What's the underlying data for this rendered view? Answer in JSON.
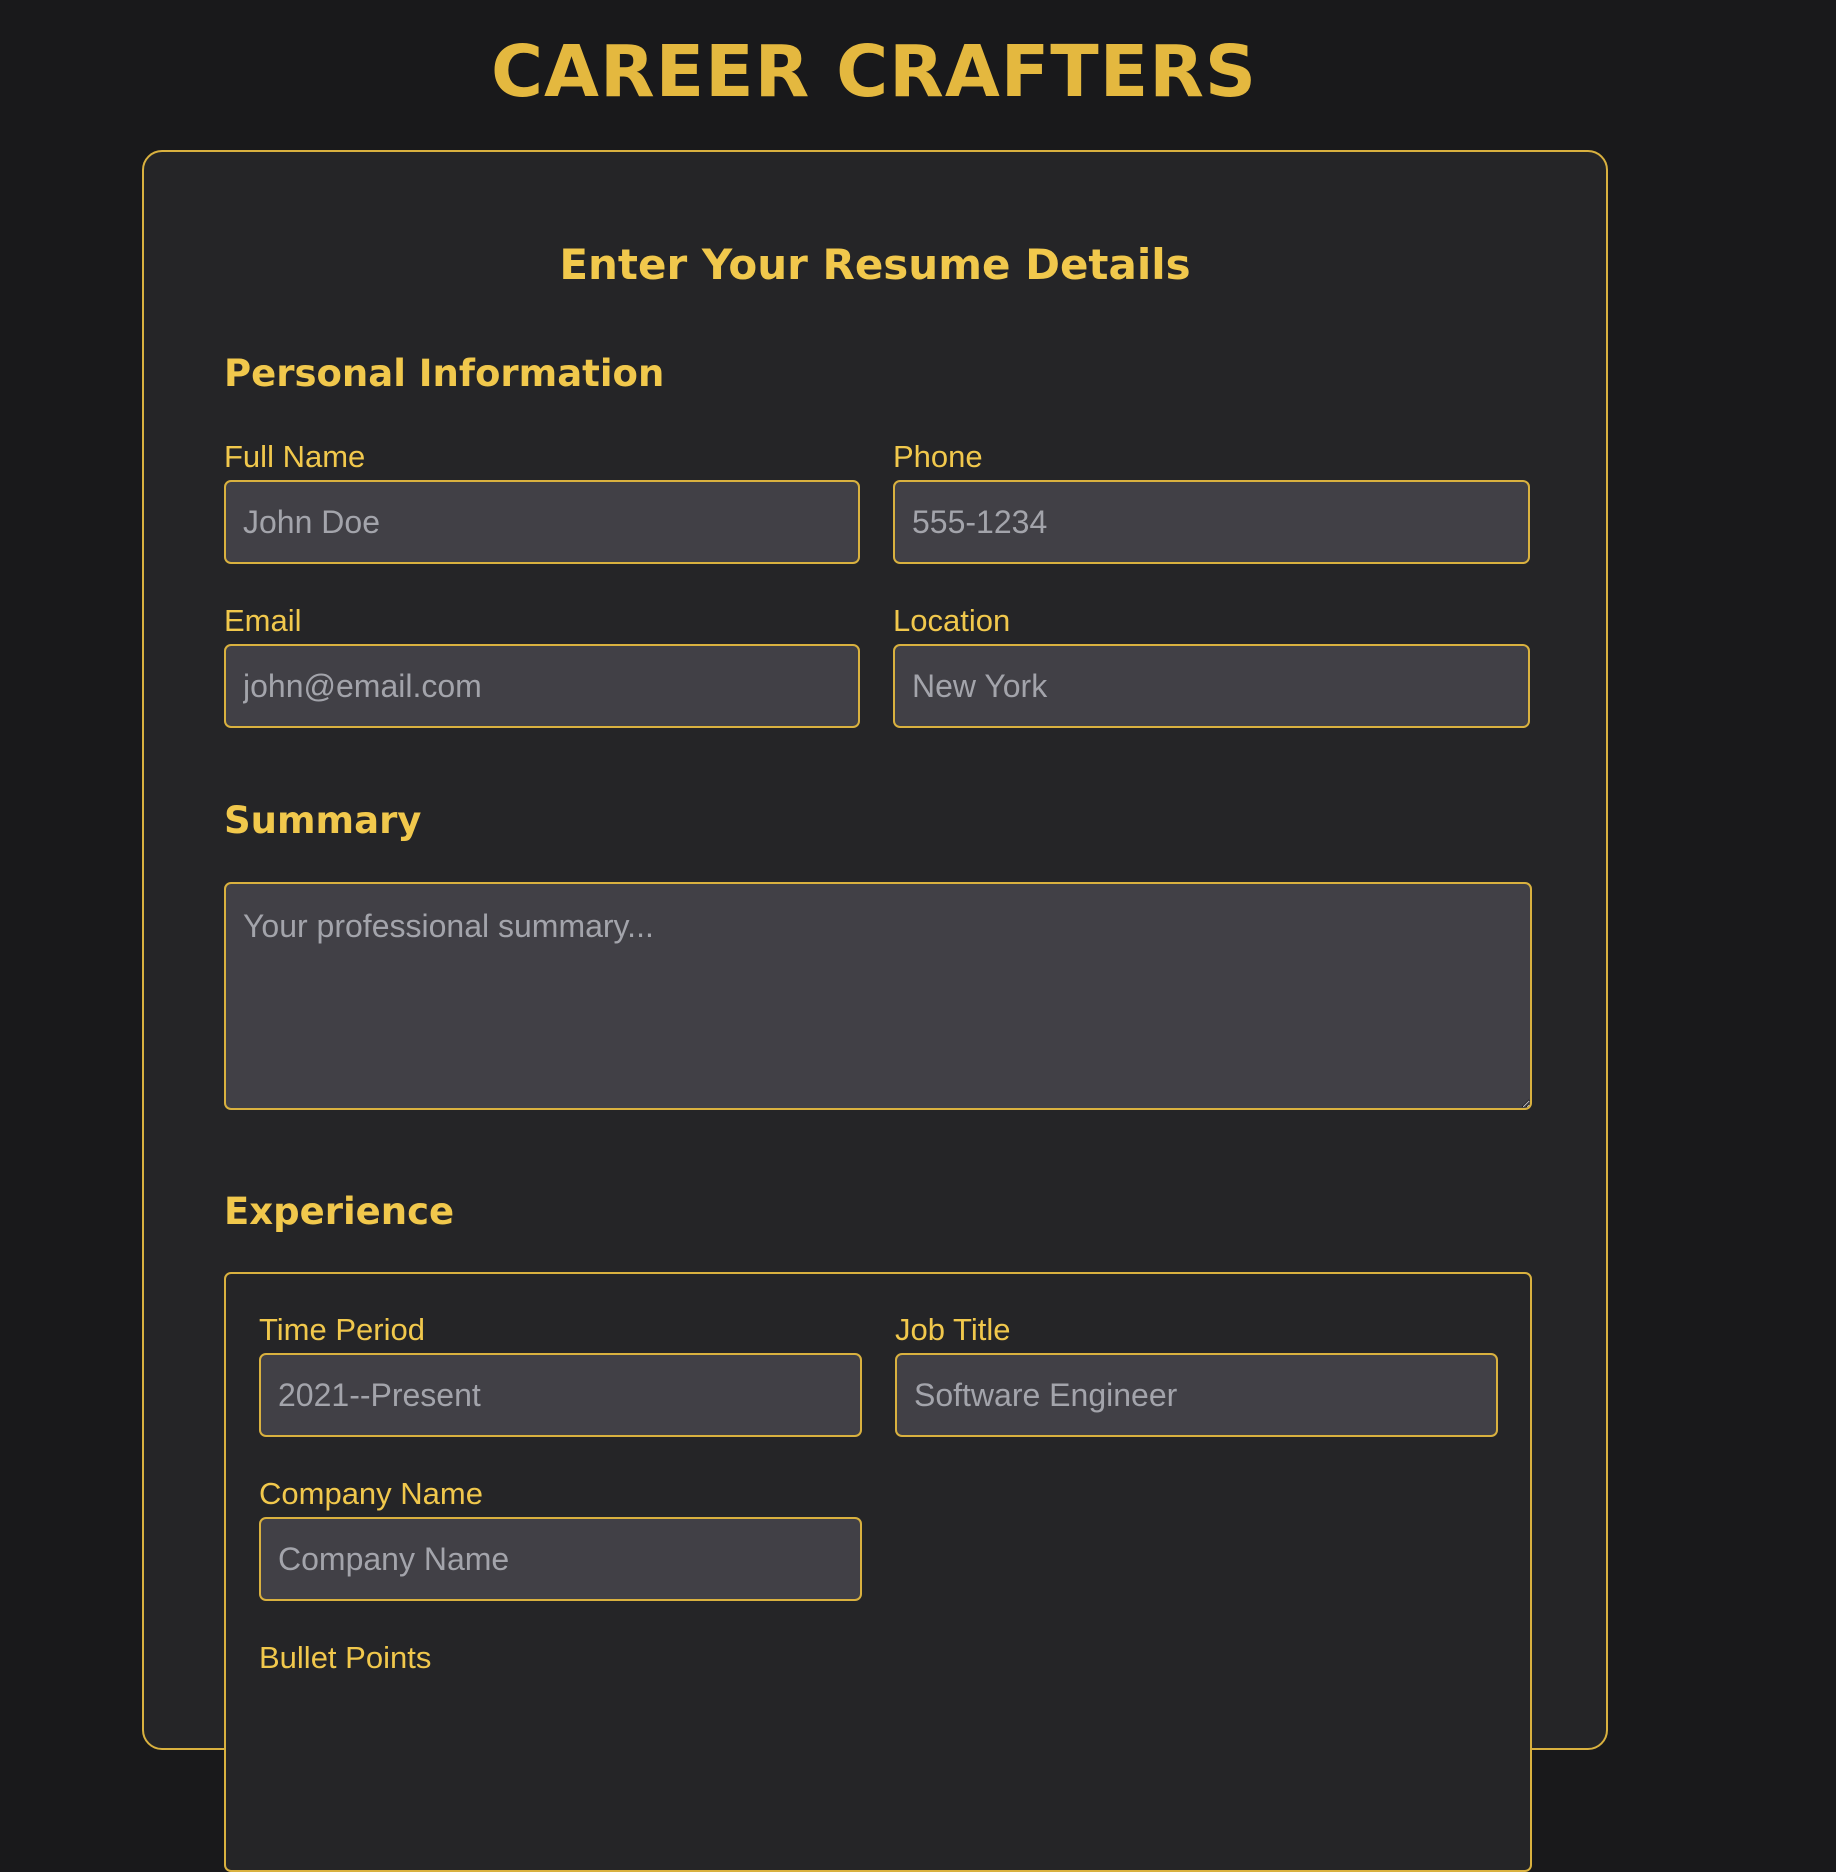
{
  "app": {
    "brand": "CAREER CRAFTERS"
  },
  "form": {
    "title": "Enter Your Resume Details"
  },
  "personal": {
    "title": "Personal Information",
    "full_name": {
      "label": "Full Name",
      "placeholder": "John Doe"
    },
    "phone": {
      "label": "Phone",
      "placeholder": "555-1234"
    },
    "email": {
      "label": "Email",
      "placeholder": "john@email.com"
    },
    "location": {
      "label": "Location",
      "placeholder": "New York"
    }
  },
  "summary": {
    "title": "Summary",
    "placeholder": "Your professional summary..."
  },
  "experience": {
    "title": "Experience",
    "time_period": {
      "label": "Time Period",
      "placeholder": "2021--Present"
    },
    "job_title": {
      "label": "Job Title",
      "placeholder": "Software Engineer"
    },
    "company": {
      "label": "Company Name",
      "placeholder": "Company Name"
    },
    "bullets": {
      "label": "Bullet Points"
    }
  },
  "colors": {
    "page_background": "#19191b",
    "card_background": "#252527",
    "accent": "#f1c84c",
    "brand": "#e4b83f",
    "input_background": "#414046",
    "placeholder_text": "#a3a4ab"
  }
}
